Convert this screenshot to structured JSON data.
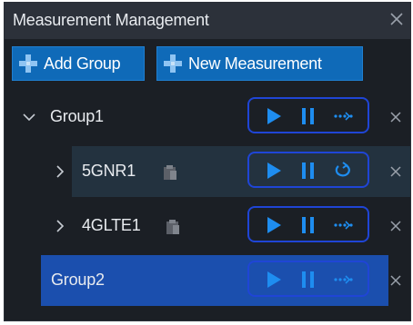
{
  "panel": {
    "title": "Measurement Management",
    "close_icon": "close-icon"
  },
  "toolbar": {
    "add_group_label": "Add Group",
    "new_measurement_label": "New Measurement",
    "plus_icon": "plus-icon"
  },
  "tree": {
    "items": [
      {
        "label": "Group1",
        "kind": "group",
        "expanded": true,
        "selected": false,
        "mode_icon": "continuous-icon"
      },
      {
        "label": "5GNR1",
        "kind": "measurement",
        "expanded": false,
        "selected": false,
        "mode_icon": "loop-icon"
      },
      {
        "label": "4GLTE1",
        "kind": "measurement",
        "expanded": false,
        "selected": false,
        "mode_icon": "continuous-icon"
      },
      {
        "label": "Group2",
        "kind": "group",
        "expanded": false,
        "selected": true,
        "mode_icon": "continuous-icon"
      }
    ]
  },
  "colors": {
    "panel_bg": "#1b1f25",
    "titlebar_bg": "#2c313a",
    "button_bg": "#0f6ab8",
    "accent_blue": "#1e8df0",
    "control_border": "#1f45d6",
    "selected_row_bg": "#1b4fae",
    "hover_row_bg": "#23323f"
  }
}
